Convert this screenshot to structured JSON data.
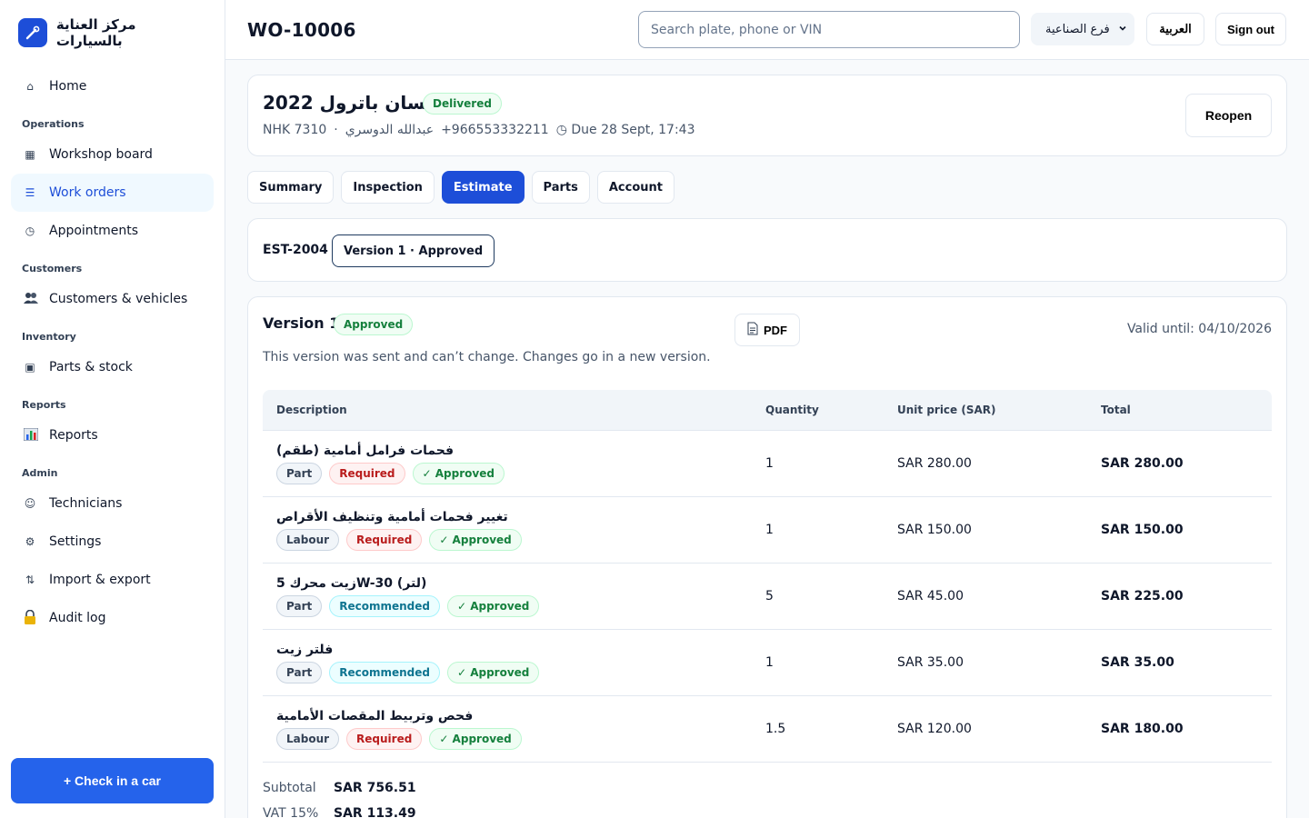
{
  "brand": {
    "name": "مركز العناية بالسيارات",
    "icon": "wrench-icon"
  },
  "sidebar": {
    "home": {
      "label": "Home",
      "icon": "home-icon"
    },
    "sections": [
      {
        "title": "Operations",
        "items": [
          {
            "label": "Workshop board",
            "icon": "grid-icon"
          },
          {
            "label": "Work orders",
            "icon": "list-icon",
            "active": true
          },
          {
            "label": "Appointments",
            "icon": "clock-icon"
          }
        ]
      },
      {
        "title": "Customers",
        "items": [
          {
            "label": "Customers & vehicles",
            "icon": "people-icon"
          }
        ]
      },
      {
        "title": "Inventory",
        "items": [
          {
            "label": "Parts & stock",
            "icon": "box-icon"
          }
        ]
      },
      {
        "title": "Reports",
        "items": [
          {
            "label": "Reports",
            "icon": "bar-chart-icon"
          }
        ]
      },
      {
        "title": "Admin",
        "items": [
          {
            "label": "Technicians",
            "icon": "smiley-icon"
          },
          {
            "label": "Settings",
            "icon": "gear-icon"
          },
          {
            "label": "Import & export",
            "icon": "updown-arrows-icon"
          },
          {
            "label": "Audit log",
            "icon": "lock-icon"
          }
        ]
      }
    ],
    "checkin": "+ Check in a car"
  },
  "topbar": {
    "title": "WO-10006",
    "search_placeholder": "Search plate, phone or VIN",
    "branch": "فرع الصناعية",
    "language": "العربية",
    "signout": "Sign out"
  },
  "vehicle": {
    "title": "نيسان باترول 2022",
    "status": "Delivered",
    "plate": "NHK 7310",
    "sep": "·",
    "customer": "عبدالله الدوسري",
    "phone": "+966553332211",
    "due": "◷ Due 28 Sept, 17:43",
    "reopen": "Reopen"
  },
  "tabs": [
    "Summary",
    "Inspection",
    "Estimate",
    "Parts",
    "Account"
  ],
  "active_tab": "Estimate",
  "estimate": {
    "id": "EST-2004",
    "version_pill": "Version 1 · Approved"
  },
  "version": {
    "title": "Version 1",
    "status": "Approved",
    "pdf": "PDF",
    "valid_until": "Valid until: 04/10/2026",
    "note": "This version was sent and can’t change. Changes go in a new version.",
    "headers": {
      "desc": "Description",
      "qty": "Quantity",
      "unit": "Unit price (SAR)",
      "total": "Total"
    },
    "rows": [
      {
        "desc": "فحمات فرامل أمامية (طقم)",
        "type": "Part",
        "priority": "Required",
        "approval": "✓ Approved",
        "qty": "1",
        "unit": "SAR 280.00",
        "total": "SAR 280.00"
      },
      {
        "desc": "تغيير فحمات أمامية وتنظيف الأقراص",
        "type": "Labour",
        "priority": "Required",
        "approval": "✓ Approved",
        "qty": "1",
        "unit": "SAR 150.00",
        "total": "SAR 150.00"
      },
      {
        "desc": "زيت محرك 5W-30 (لتر)",
        "type": "Part",
        "priority": "Recommended",
        "approval": "✓ Approved",
        "qty": "5",
        "unit": "SAR 45.00",
        "total": "SAR 225.00"
      },
      {
        "desc": "فلتر زيت",
        "type": "Part",
        "priority": "Recommended",
        "approval": "✓ Approved",
        "qty": "1",
        "unit": "SAR 35.00",
        "total": "SAR 35.00"
      },
      {
        "desc": "فحص وتربيط المقصات الأمامية",
        "type": "Labour",
        "priority": "Required",
        "approval": "✓ Approved",
        "qty": "1.5",
        "unit": "SAR 120.00",
        "total": "SAR 180.00"
      }
    ],
    "totals": [
      {
        "label": "Subtotal",
        "value": "SAR 756.51"
      },
      {
        "label": "VAT 15%",
        "value": "SAR 113.49"
      }
    ]
  },
  "colors": {
    "accent": "#1d4ed8",
    "button": "#2563eb",
    "approved": "#15803d",
    "required": "#b91c1c",
    "recommended": "#0e7490"
  }
}
